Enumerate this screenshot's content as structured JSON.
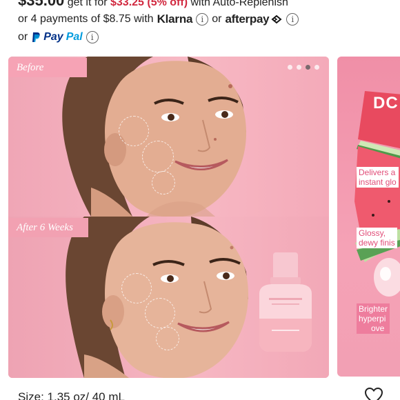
{
  "pricing": {
    "line1_price": "$35.00",
    "line1_middle": " get it for ",
    "line1_sale": "$33.25 (5% off)",
    "line1_end": " with Auto-Replenish",
    "line2_text": "or 4 payments of $8.75 with",
    "klarna_label": "Klarna",
    "or_text": "or",
    "afterpay_label": "afterpay",
    "line3_or": "or",
    "paypal_pay": "Pay",
    "paypal_pal": "Pal",
    "info_glyph": "i"
  },
  "gallery": {
    "before_label": "Before",
    "after_label": "After 6 Weeks",
    "dots_count": 4,
    "active_dot_index": 2
  },
  "side_card": {
    "title": "DC",
    "tag1_line1": "Delivers a",
    "tag1_line2": "instant glo",
    "tag2_line1": "Glossy,",
    "tag2_line2": "dewy finis",
    "tag3_line1": "Brighter",
    "tag3_line2": "hyperpi",
    "tag3_line3": "ove"
  },
  "product": {
    "size_text": "Size: 1.35 oz/ 40 mL"
  },
  "colors": {
    "sale_red": "#d1283f",
    "brand_pink": "#f6a3b5",
    "paypal_dark": "#003087",
    "paypal_light": "#009cde"
  },
  "icons": [
    "info-icon",
    "afterpay-arrows-icon",
    "paypal-logo-icon",
    "heart-icon"
  ]
}
